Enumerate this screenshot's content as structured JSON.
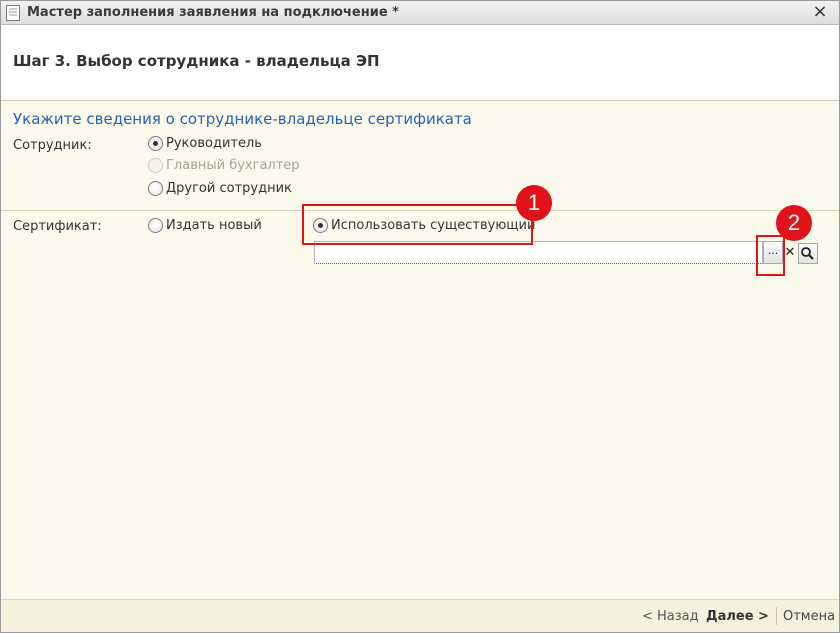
{
  "window": {
    "title": "Мастер заполнения заявления на подключение *",
    "close_glyph": "×"
  },
  "header": {
    "step_title": "Шаг 3. Выбор сотрудника - владельца ЭП"
  },
  "employee_section": {
    "heading": "Укажите сведения о сотруднике-владельце сертификата",
    "label": "Сотрудник:",
    "options": [
      {
        "label": "Руководитель",
        "selected": true,
        "enabled": true
      },
      {
        "label": "Главный бухгалтер",
        "selected": false,
        "enabled": false
      },
      {
        "label": "Другой сотрудник",
        "selected": false,
        "enabled": true
      }
    ]
  },
  "certificate_section": {
    "label": "Сертификат:",
    "options": [
      {
        "label": "Издать новый",
        "selected": false
      },
      {
        "label": "Использовать существующий",
        "selected": true
      }
    ],
    "field_value": "",
    "select_button_label": "...",
    "clear_glyph": "✕",
    "open_icon": "magnifier-icon"
  },
  "annotations": {
    "badge_1": "1",
    "badge_2": "2",
    "color": "#e0121a"
  },
  "footer": {
    "back_label": "< Назад",
    "next_label": "Далее >",
    "cancel_label": "Отмена"
  }
}
